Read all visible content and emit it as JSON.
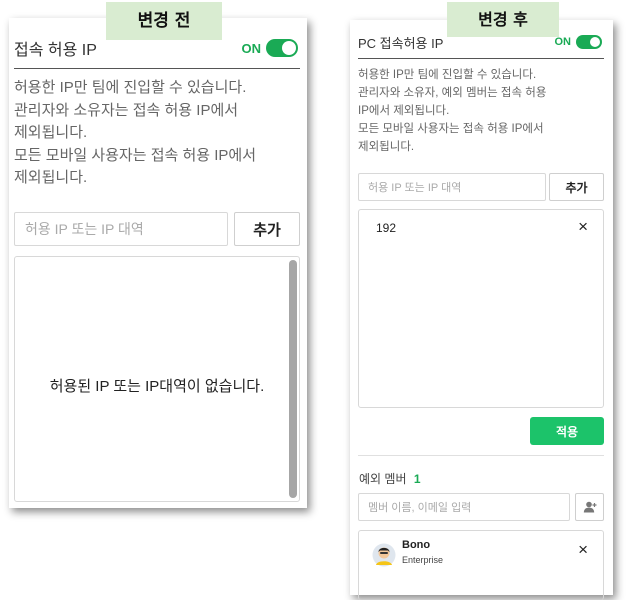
{
  "before": {
    "tag": "변경 전",
    "title": "접속 허용 IP",
    "toggle_label": "ON",
    "desc_lines": [
      "허용한 IP만 팀에 진입할 수 있습니다.",
      "관리자와 소유자는 접속 허용 IP에서",
      "제외됩니다.",
      "모든 모바일 사용자는 접속 허용 IP에서",
      "제외됩니다."
    ],
    "ip_placeholder": "허용 IP 또는 IP 대역",
    "add_label": "추가",
    "empty_text": "허용된 IP 또는 IP대역이 없습니다."
  },
  "after": {
    "tag": "변경 후",
    "title": "PC 접속허용 IP",
    "toggle_label": "ON",
    "desc_lines": [
      "허용한 IP만 팀에 진입할 수 있습니다.",
      "관리자와 소유자, 예외 멤버는 접속 허용",
      "IP에서 제외됩니다.",
      "모든 모바일 사용자는 접속 허용 IP에서",
      "제외됩니다."
    ],
    "ip_placeholder": "허용 IP 또는 IP 대역",
    "add_label": "추가",
    "ip_entry": "192",
    "close_symbol": "×",
    "apply_label": "적용",
    "exception_label": "예외 멤버",
    "exception_count": "1",
    "member_placeholder": "멤버 이름, 이메일 입력",
    "member_name": "Bono",
    "member_plan": "Enterprise"
  },
  "colors": {
    "accent": "#1aaa55",
    "apply": "#1cc36a",
    "tag_bg": "#d9ecd1"
  }
}
